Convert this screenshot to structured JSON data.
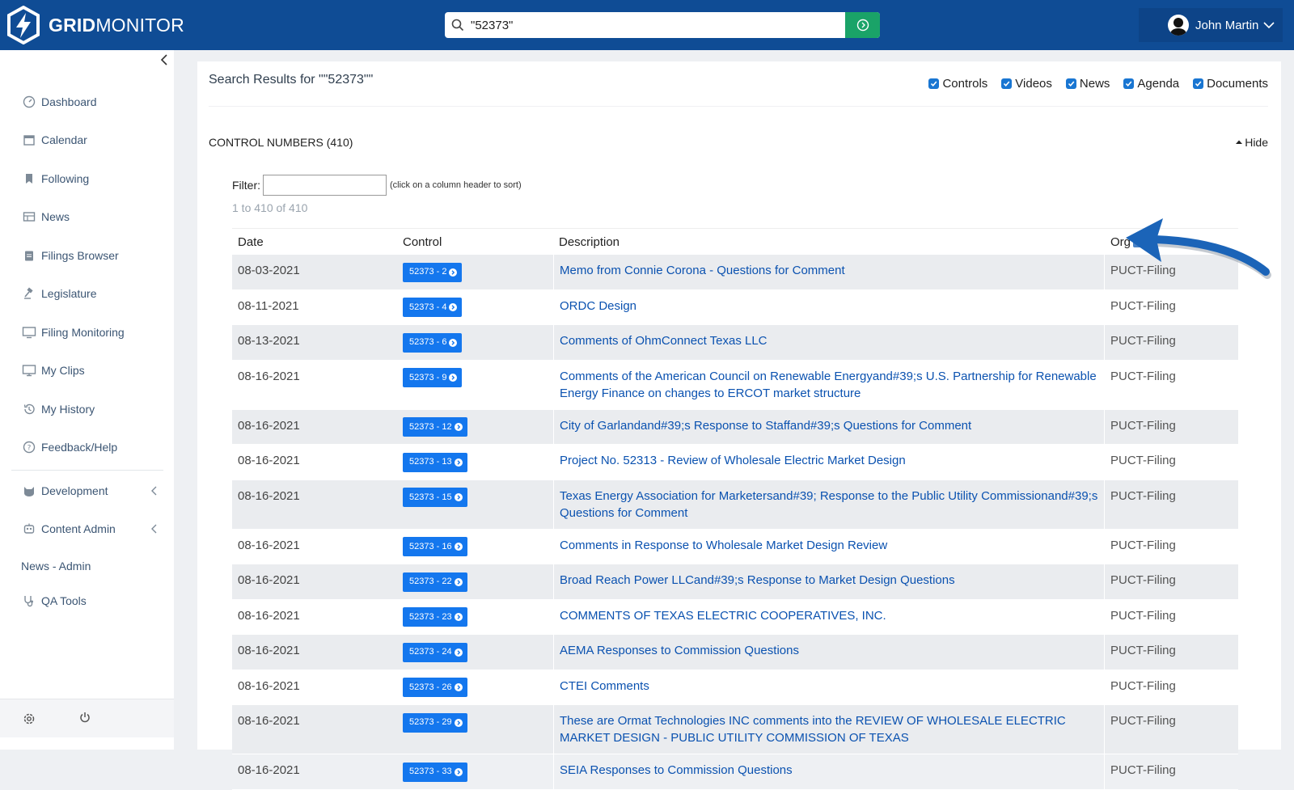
{
  "app": {
    "logo_bold": "GRID",
    "logo_light": "MONITOR"
  },
  "search": {
    "value": "\"52373\""
  },
  "user": {
    "name": "John Martin"
  },
  "sidebar": {
    "items": [
      {
        "label": "Dashboard",
        "icon": "dashboard-icon"
      },
      {
        "label": "Calendar",
        "icon": "calendar-icon"
      },
      {
        "label": "Following",
        "icon": "bookmark-icon"
      },
      {
        "label": "News",
        "icon": "news-icon"
      },
      {
        "label": "Filings Browser",
        "icon": "clipboard-icon"
      },
      {
        "label": "Legislature",
        "icon": "gavel-icon"
      },
      {
        "label": "Filing Monitoring",
        "icon": "monitor-icon"
      },
      {
        "label": "My Clips",
        "icon": "clips-icon"
      },
      {
        "label": "My History",
        "icon": "history-icon"
      },
      {
        "label": "Feedback/Help",
        "icon": "help-icon"
      }
    ],
    "admin": [
      {
        "label": "Development",
        "icon": "cat-icon",
        "chevron": true
      },
      {
        "label": "Content Admin",
        "icon": "robot-icon",
        "chevron": true
      },
      {
        "label": "News - Admin",
        "icon": "",
        "chevron": false
      },
      {
        "label": "QA Tools",
        "icon": "stethoscope-icon",
        "chevron": false
      }
    ]
  },
  "results": {
    "title": "Search Results for \"\"52373\"\"",
    "filters": [
      "Controls",
      "Videos",
      "News",
      "Agenda",
      "Documents"
    ],
    "section_title": "CONTROL NUMBERS (410)",
    "hide_label": "Hide",
    "filter_label": "Filter:",
    "filter_hint": "(click on a column header to sort)",
    "range_text": "1 to 410 of 410",
    "columns": [
      "Date",
      "Control",
      "Description",
      "Org"
    ],
    "rows": [
      {
        "date": "08-03-2021",
        "control": "52373 - 2",
        "description": "Memo from Connie Corona - Questions for Comment",
        "org": "PUCT-Filing"
      },
      {
        "date": "08-11-2021",
        "control": "52373 - 4",
        "description": "ORDC Design",
        "org": "PUCT-Filing"
      },
      {
        "date": "08-13-2021",
        "control": "52373 - 6",
        "description": "Comments of OhmConnect Texas LLC",
        "org": "PUCT-Filing"
      },
      {
        "date": "08-16-2021",
        "control": "52373 - 9",
        "description": "Comments of the American Council on Renewable Energyand#39;s U.S. Partnership for Renewable Energy Finance on changes to ERCOT market structure",
        "org": "PUCT-Filing"
      },
      {
        "date": "08-16-2021",
        "control": "52373 - 12",
        "description": "City of Garlandand#39;s Response to Staffand#39;s Questions for Comment",
        "org": "PUCT-Filing"
      },
      {
        "date": "08-16-2021",
        "control": "52373 - 13",
        "description": "Project No. 52313 - Review of Wholesale Electric Market Design",
        "org": "PUCT-Filing"
      },
      {
        "date": "08-16-2021",
        "control": "52373 - 15",
        "description": "Texas Energy Association for Marketersand#39; Response to the Public Utility Commissionand#39;s Questions for Comment",
        "org": "PUCT-Filing"
      },
      {
        "date": "08-16-2021",
        "control": "52373 - 16",
        "description": "Comments in Response to Wholesale Market Design Review",
        "org": "PUCT-Filing"
      },
      {
        "date": "08-16-2021",
        "control": "52373 - 22",
        "description": "Broad Reach Power LLCand#39;s Response to Market Design Questions",
        "org": "PUCT-Filing"
      },
      {
        "date": "08-16-2021",
        "control": "52373 - 23",
        "description": "COMMENTS OF TEXAS ELECTRIC COOPERATIVES, INC.",
        "org": "PUCT-Filing"
      },
      {
        "date": "08-16-2021",
        "control": "52373 - 24",
        "description": "AEMA Responses to Commission Questions",
        "org": "PUCT-Filing"
      },
      {
        "date": "08-16-2021",
        "control": "52373 - 26",
        "description": "CTEI Comments",
        "org": "PUCT-Filing"
      },
      {
        "date": "08-16-2021",
        "control": "52373 - 29",
        "description": "These are Ormat Technologies INC comments into the REVIEW OF WHOLESALE ELECTRIC MARKET DESIGN - PUBLIC UTILITY COMMISSION OF TEXAS",
        "org": "PUCT-Filing"
      },
      {
        "date": "08-16-2021",
        "control": "52373 - 33",
        "description": "SEIA Responses to Commission Questions",
        "org": "PUCT-Filing"
      }
    ]
  },
  "colors": {
    "topbar": "#0f4c95",
    "search_go": "#1aa368",
    "link": "#0b52b0",
    "badge": "#1477ee",
    "arrow": "#1b64b8"
  }
}
